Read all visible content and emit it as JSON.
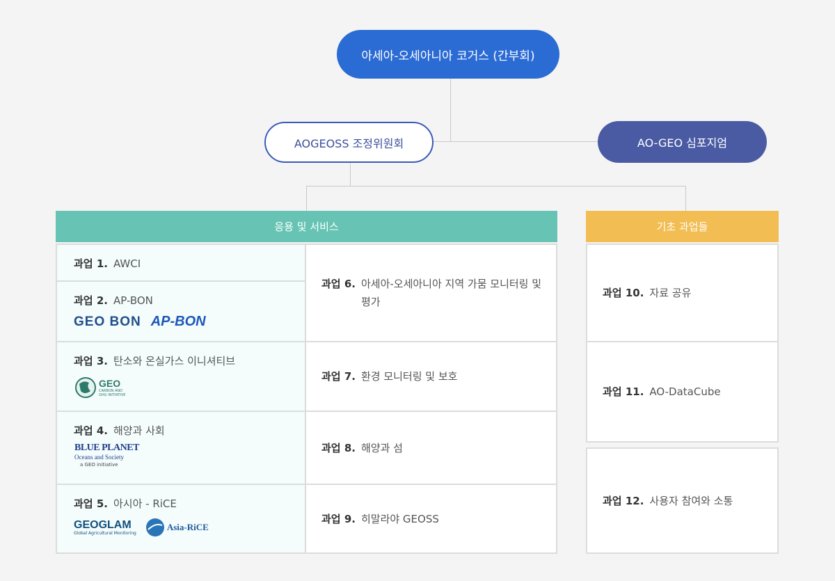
{
  "top": {
    "label": "아세아-오세아니아 코거스 (간부회)"
  },
  "coordination": {
    "label": "AOGEOSS 조정위원회"
  },
  "symposium": {
    "label": "AO-GEO 심포지엄"
  },
  "application": {
    "title": "응용 및 서비스",
    "left_tasks": [
      {
        "num": "과업 1.",
        "name": "AWCI"
      },
      {
        "num": "과업 2.",
        "name": "AP-BON",
        "logos": [
          "GEO BON",
          "AP-BON"
        ]
      },
      {
        "num": "과업 3.",
        "name": "탄소와 온실가스 이니셔티브",
        "logos": [
          "GEO"
        ],
        "logo_small": [
          "CARBON AND",
          "GHG INITIATIVE"
        ]
      },
      {
        "num": "과업 4.",
        "name": "해양과 사회",
        "logos": [
          "BLUE PLANET"
        ],
        "logo_small": [
          "Oceans and Society",
          "a GEO initiative"
        ]
      },
      {
        "num": "과업 5.",
        "name": "아시아 - RiCE",
        "logos": [
          "GEOGLAM",
          "Asia-RiCE"
        ],
        "logo_small": [
          "Global Agricultural Monitoring"
        ]
      }
    ],
    "right_tasks": [
      {
        "num": "과업 6.",
        "name": "아세아-오세아니아 지역 가뭄 모니터링 및 평가"
      },
      {
        "num": "과업 7.",
        "name": "환경 모니터링 및 보호"
      },
      {
        "num": "과업 8.",
        "name": "해양과 섬"
      },
      {
        "num": "과업 9.",
        "name": "히말라야 GEOSS"
      }
    ]
  },
  "foundation": {
    "title": "기초 과업들",
    "tasks": [
      {
        "num": "과업 10.",
        "name": "자료 공유"
      },
      {
        "num": "과업 11.",
        "name": "AO-DataCube"
      },
      {
        "num": "과업 12.",
        "name": "사용자 참여와 소통"
      }
    ]
  },
  "colors": {
    "top": "#2b6bd4",
    "symposium": "#4a5ba4",
    "application": "#67c4b4",
    "foundation": "#f2bd52",
    "coordination_border": "#3a5ab8"
  }
}
